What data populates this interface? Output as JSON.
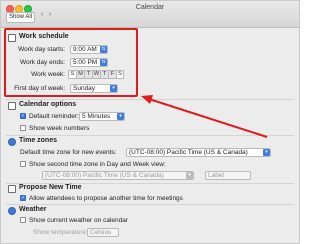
{
  "window": {
    "title": "Calendar",
    "show_all": "Show All",
    "back": "‹",
    "forward": "›"
  },
  "work_schedule": {
    "title": "Work schedule",
    "start_label": "Work day starts:",
    "start_value": "9:00 AM",
    "end_label": "Work day ends:",
    "end_value": "5:00 PM",
    "week_label": "Work week:",
    "days": [
      "S",
      "M",
      "T",
      "W",
      "T",
      "F",
      "S"
    ],
    "selected_days": [
      false,
      true,
      true,
      true,
      true,
      true,
      false
    ],
    "first_day_label": "First day of week:",
    "first_day_value": "Sunday"
  },
  "calendar_options": {
    "title": "Calendar options",
    "default_reminder_label": "Default reminder:",
    "default_reminder_checked": true,
    "reminder_value": "5 Minutes",
    "show_week_numbers": "Show week numbers",
    "show_week_numbers_checked": false
  },
  "time_zones": {
    "title": "Time zones",
    "default_label": "Default time zone for new events:",
    "default_value": "(UTC-08:00) Pacific Time (US & Canada)",
    "second_label": "Show second time zone in Day and Week view:",
    "second_checked": false,
    "second_value": "(UTC-08:00) Pacific Time (US & Canada)",
    "second_placeholder": "Label"
  },
  "propose_new_time": {
    "title": "Propose New Time",
    "allow_label": "Allow attendees to propose another time for meetings",
    "allow_checked": true
  },
  "weather": {
    "title": "Weather",
    "show_label": "Show current weather on calendar",
    "show_checked": false,
    "temp_label": "Show temperature in:",
    "temp_value": "Celsius"
  },
  "annotation": {
    "highlight_color": "#e01b1b"
  }
}
